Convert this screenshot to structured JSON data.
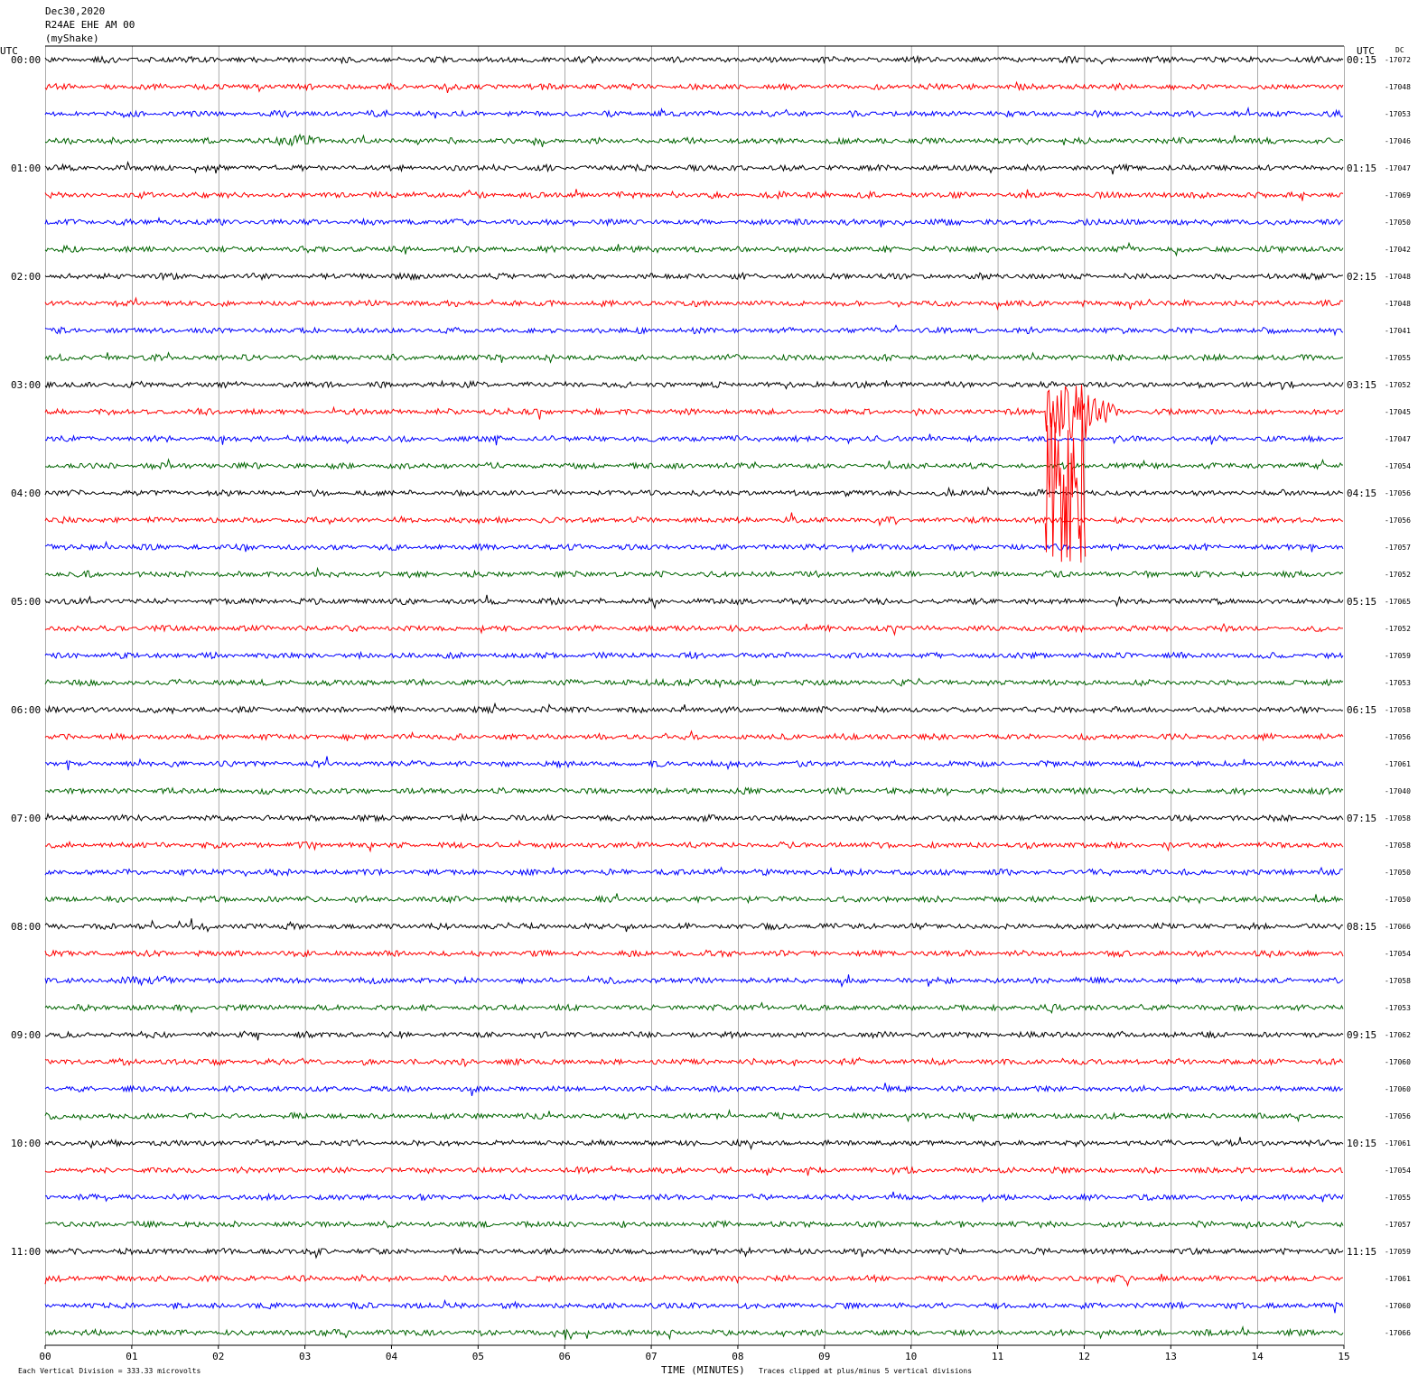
{
  "header": {
    "date": "Dec30,2020",
    "station": "R24AE EHE AM 00",
    "network": "(myShake)"
  },
  "footer": {
    "left_note": "Each Vertical Division =  333.33 microvolts",
    "xlabel": "TIME (MINUTES)",
    "clip_note": "Traces clipped at plus/minus 5 vertical divisions"
  },
  "colors": {
    "trace_cycle": [
      "#000000",
      "#ff0000",
      "#0000ff",
      "#006400"
    ],
    "grid": "#000000",
    "background": "#ffffff"
  },
  "chart_data": {
    "type": "line",
    "description_kind": "helicorder",
    "left_axis_title": "UTC",
    "right_axis_title": "UTC",
    "dc_title": "DC",
    "xlim": [
      0,
      15
    ],
    "x_ticks": [
      "00",
      "01",
      "02",
      "03",
      "04",
      "05",
      "06",
      "07",
      "08",
      "09",
      "10",
      "11",
      "12",
      "13",
      "14",
      "15"
    ],
    "left_hour_labels": [
      "00:00",
      "01:00",
      "02:00",
      "03:00",
      "04:00",
      "05:00",
      "06:00",
      "07:00",
      "08:00",
      "09:00",
      "10:00",
      "11:00"
    ],
    "right_hour_labels": [
      "00:15",
      "01:15",
      "02:15",
      "03:15",
      "04:15",
      "05:15",
      "06:15",
      "07:15",
      "08:15",
      "09:15",
      "10:15",
      "11:15"
    ],
    "rows_per_hour": 4,
    "minutes_per_row": 15,
    "dc_offsets": [
      -17072,
      -17048,
      -17053,
      -17046,
      -17047,
      -17069,
      -17050,
      -17042,
      -17048,
      -17048,
      -17041,
      -17055,
      -17052,
      -17045,
      -17047,
      -17054,
      -17056,
      -17056,
      -17057,
      -17052,
      -17065,
      -17052,
      -17059,
      -17053,
      -17058,
      -17056,
      -17061,
      -17040,
      -17058,
      -17058,
      -17050,
      -17050,
      -17066,
      -17054,
      -17058,
      -17053,
      -17062,
      -17060,
      -17060,
      -17056,
      -17061,
      -17054,
      -17055,
      -17057,
      -17059,
      -17061,
      -17060,
      -17066
    ],
    "events": [
      {
        "row": 3,
        "start_min": 2.5,
        "end_min": 3.3,
        "amplitude_div": 1.2
      },
      {
        "row": 5,
        "start_min": 5.4,
        "end_min": 5.6,
        "amplitude_div": 0.8
      },
      {
        "row": 5,
        "start_min": 7.6,
        "end_min": 7.8,
        "amplitude_div": 0.7
      },
      {
        "row": 5,
        "start_min": 8.4,
        "end_min": 8.6,
        "amplitude_div": 0.8
      },
      {
        "row": 13,
        "start_min": 11.55,
        "end_min": 12.4,
        "amplitude_div": 5.0,
        "clipped": true,
        "coda_rows": 5
      },
      {
        "row": 23,
        "start_min": 5.8,
        "end_min": 8.6,
        "amplitude_div": 0.6
      },
      {
        "row": 34,
        "start_min": 0.7,
        "end_min": 1.7,
        "amplitude_div": 1.0
      },
      {
        "row": 43,
        "start_min": 3.4,
        "end_min": 3.6,
        "amplitude_div": 0.7
      }
    ]
  }
}
